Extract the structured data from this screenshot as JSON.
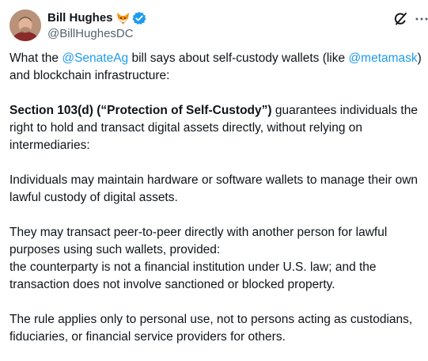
{
  "author": {
    "name": "Bill Hughes",
    "handle": "@BillHughesDC",
    "badge_icon": "fox-emoji-icon",
    "verified_icon": "verified-badge-icon",
    "verified_color": "#1d9bf0"
  },
  "actions": {
    "grok_icon": "grok-icon",
    "more_icon": "more-options-icon"
  },
  "tweet": {
    "p1": {
      "a": "What the ",
      "mention1": "@SenateAg",
      "b": " bill says about self-custody wallets (like ",
      "mention2": "@metamask",
      "c": ") and blockchain infrastructure:"
    },
    "p2": {
      "bold": "Section 103(d) (“Protection of Self-Custody”)",
      "rest": " guarantees individuals the right to hold and transact digital assets directly, without relying on intermediaries:"
    },
    "p3": "Individuals may maintain hardware or software wallets to manage their own lawful custody of digital assets.",
    "p4": {
      "line1": "They may transact peer-to-peer directly with another person for lawful purposes using such wallets, provided:",
      "line2": "the counterparty is not a financial institution under U.S. law; and the transaction does not involve sanctioned or blocked property."
    },
    "p5": "The rule applies only to personal use, not to persons acting as custodians, fiduciaries, or financial service providers for others."
  },
  "colors": {
    "link": "#1d9bf0",
    "text": "#0f1419",
    "secondary": "#536471"
  }
}
